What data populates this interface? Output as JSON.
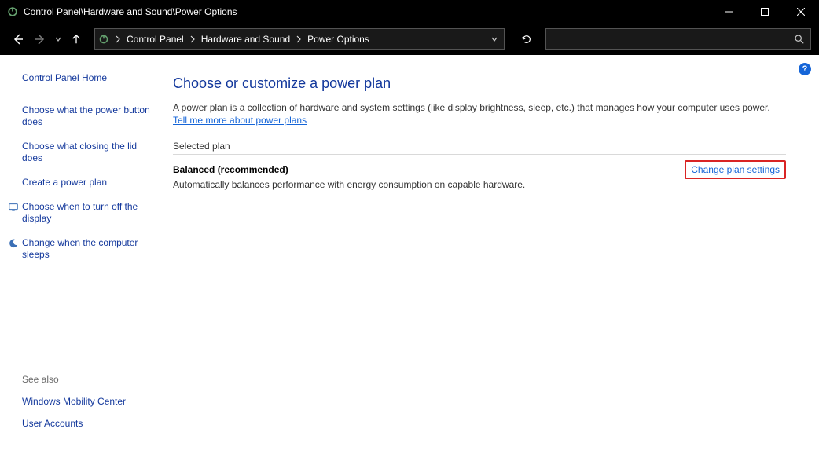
{
  "titlebar": {
    "title": "Control Panel\\Hardware and Sound\\Power Options"
  },
  "breadcrumb": {
    "seg0": "Control Panel",
    "seg1": "Hardware and Sound",
    "seg2": "Power Options"
  },
  "search": {
    "placeholder": ""
  },
  "sidebar": {
    "home": "Control Panel Home",
    "links": [
      "Choose what the power button does",
      "Choose what closing the lid does",
      "Create a power plan",
      "Choose when to turn off the display",
      "Change when the computer sleeps"
    ],
    "see_also_label": "See also",
    "see_also": [
      "Windows Mobility Center",
      "User Accounts"
    ]
  },
  "main": {
    "heading": "Choose or customize a power plan",
    "description_pre": "A power plan is a collection of hardware and system settings (like display brightness, sleep, etc.) that manages how your computer uses power. ",
    "description_link": "Tell me more about power plans",
    "section_label": "Selected plan",
    "plan_title": "Balanced (recommended)",
    "plan_desc": "Automatically balances performance with energy consumption on capable hardware.",
    "change_link": "Change plan settings"
  }
}
